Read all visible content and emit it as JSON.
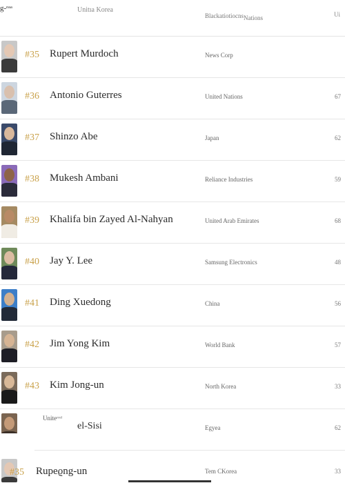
{
  "header": {
    "left": "g-ᵉᵃᵃ",
    "col_country": "Unitıa Korea",
    "col_org": "Blackatiotiocns",
    "col_org_suffix": "Nations",
    "col_edge": "Ui"
  },
  "rows": [
    {
      "rank": "#35",
      "name": "Rupert Murdoch",
      "org": "News Corp",
      "age": "",
      "avatar": {
        "bg": "#c8c8c8",
        "skin": "#e4c8b4",
        "suit": "#3b3b3b"
      }
    },
    {
      "rank": "#36",
      "name": "Antonio Guterres",
      "org": "United Nations",
      "age": "67",
      "avatar": {
        "bg": "#cdd6e0",
        "skin": "#d9c0ae",
        "suit": "#5b6878"
      }
    },
    {
      "rank": "#37",
      "name": "Shinzo Abe",
      "org": "Japan",
      "age": "62",
      "avatar": {
        "bg": "#3a4a6a",
        "skin": "#d8b89c",
        "suit": "#1f2633"
      }
    },
    {
      "rank": "#38",
      "name": "Mukesh Ambani",
      "org": "Reliance Industries",
      "age": "59",
      "avatar": {
        "bg": "#8a6ab8",
        "skin": "#8e6448",
        "suit": "#2b2b3a"
      }
    },
    {
      "rank": "#39",
      "name": "Khalifa bin Zayed Al-Nahyan",
      "org": "United Arab Emirates",
      "age": "68",
      "avatar": {
        "bg": "#a58a62",
        "skin": "#b88a66",
        "suit": "#f0ece4"
      }
    },
    {
      "rank": "#40",
      "name": "Jay Y. Lee",
      "org": "Samsung Electronics",
      "age": "48",
      "avatar": {
        "bg": "#6f8a5a",
        "skin": "#dcbca2",
        "suit": "#24283a"
      }
    },
    {
      "rank": "#41",
      "name": "Ding Xuedong",
      "org": "China",
      "age": "56",
      "avatar": {
        "bg": "#3c7ec8",
        "skin": "#d2b090",
        "suit": "#222a38"
      }
    },
    {
      "rank": "#42",
      "name": "Jim Yong Kim",
      "org": "World Bank",
      "age": "57",
      "avatar": {
        "bg": "#a89c8c",
        "skin": "#d6b494",
        "suit": "#1e1e26"
      }
    },
    {
      "rank": "#43",
      "name": "Kim Jong-un",
      "org": "North Korea",
      "age": "33",
      "avatar": {
        "bg": "#7a6a5a",
        "skin": "#d8b898",
        "suit": "#1a1a1a"
      }
    },
    {
      "rank": "",
      "name": "el-Sisi",
      "org": "Egyea",
      "age": "62",
      "glitch": "Uniteʳʳᵒˡ",
      "avatar": {
        "bg": "#7a6450",
        "skin": "#c49a78",
        "suit": "#3a2e26"
      }
    },
    {
      "rank": "#35",
      "name": "Rupeϱng-un",
      "org": "Tem CKorea",
      "age": "33",
      "avatar": {
        "bg": "#c8c8c8",
        "skin": "#e4c8b4",
        "suit": "#3b3b3b"
      }
    }
  ]
}
